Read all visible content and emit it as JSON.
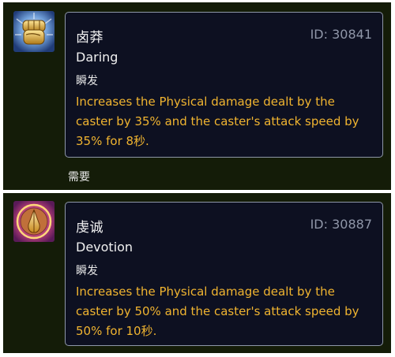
{
  "spells": [
    {
      "icon": "gold-fist-icon",
      "name": "卤莽",
      "id_text": "ID: 30841",
      "name_en": "Daring",
      "cast": "瞬发",
      "description": "Increases the Physical damage dealt by the caster by 35% and the caster's attack speed by 35% for 8秒."
    },
    {
      "icon": "praying-hands-icon",
      "name": "虔诚",
      "id_text": "ID: 30887",
      "name_en": "Devotion",
      "cast": "瞬发",
      "description": "Increases the Physical damage dealt by the caster by 50% and the caster's attack speed by 50% for 10秒."
    }
  ],
  "requires_label": "需要",
  "colors": {
    "panel_bg": "#141c08",
    "tooltip_bg": "#0d1021",
    "tooltip_border": "#8e97a8",
    "id_text": "#8f96a8",
    "description_text": "#f0b430",
    "title_text": "#f2f2f2"
  }
}
